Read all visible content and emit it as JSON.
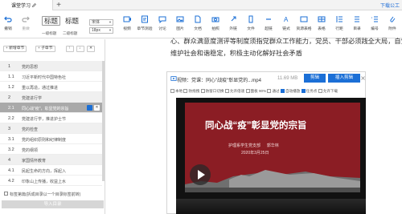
{
  "tabbar": {
    "tab_label": "课堂学习",
    "top_link": "下载公工"
  },
  "toolbar": {
    "undo": "撤销",
    "redo": "重做",
    "heading1": "标题",
    "heading2": "标题",
    "heading1_sub": "一级标题",
    "heading2_sub": "二级标题",
    "font_select": "宋体",
    "size_select": "18px",
    "buttons": [
      "视频",
      "章节测验",
      "讨论",
      "图片",
      "文档",
      "拍照",
      "外链",
      "文件",
      "超链",
      "链式",
      "资源表格",
      "表格",
      "行距",
      "目录",
      "编号",
      "附件"
    ]
  },
  "left": {
    "new_chapter_label": "+ 新增章节",
    "new_section_label": "+ 子章节",
    "rows": [
      {
        "num": "1",
        "txt": "党的思想"
      },
      {
        "num": "1.1",
        "txt": "习近平新时代中国特色社"
      },
      {
        "num": "1.2",
        "txt": "重以再造，通过推进"
      },
      {
        "num": "2",
        "txt": "党建进行学"
      },
      {
        "num": "2.1",
        "txt": "同心战\"疫\"，彰显党的宗旨"
      },
      {
        "num": "2.2",
        "txt": "党建进行学，推进护士节"
      },
      {
        "num": "3",
        "txt": "党的检查"
      },
      {
        "num": "3.1",
        "txt": "党的组织原则和纪律制度"
      },
      {
        "num": "3.2",
        "txt": "党的纲领"
      },
      {
        "num": "4",
        "txt": "家国情怀教育"
      },
      {
        "num": "4.1",
        "txt": "民起生命的方向，挥起入"
      },
      {
        "num": "4.2",
        "txt": "印象山上传播，收益上水"
      }
    ],
    "footer_label": "标签第篇(拆成目录以一个目录标签前转)",
    "import_label": "导入目录"
  },
  "editor": {
    "line1": "心、群众满意度测评等制度须指党群众工作能力，党员、干部必须践全大局，自觉",
    "line2": "维护社会和谐稳定，积极主动化解好社会矛盾"
  },
  "video": {
    "title": "视频：党课：同心\"战疫\"彰显党的...mp4",
    "size": "11.69 MB",
    "edit_label": "剪辑",
    "insert_label": "插入剪辑",
    "options": [
      "本地",
      "防拖拽",
      "防窗口切换",
      "允许倍速",
      "面板 90%",
      "通过",
      "自动播放",
      "任务点",
      "允许下载"
    ],
    "slide_title": "同心战“疫”彰显党的宗旨",
    "slide_sub1": "护理系学生党支部 　 郭华林",
    "slide_sub2": "2020年3月25日"
  },
  "colors": {
    "accent": "#1b6fd6",
    "slide": "#8b1d24"
  }
}
